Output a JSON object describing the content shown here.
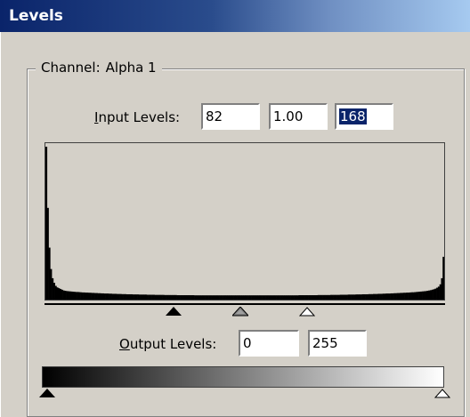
{
  "window": {
    "title": "Levels"
  },
  "channel": {
    "label": "Channel:",
    "value": "Alpha 1"
  },
  "input_levels": {
    "label_first": "I",
    "label_rest": "nput Levels:",
    "black": "82",
    "gamma": "1.00",
    "white": "168"
  },
  "output_levels": {
    "label_first": "O",
    "label_rest": "utput Levels:",
    "black": "0",
    "white": "255"
  },
  "histogram": {
    "levels": 256,
    "counts": [
      1.0,
      0.6,
      0.34,
      0.2,
      0.14,
      0.11,
      0.09,
      0.08,
      0.075,
      0.07,
      0.065,
      0.06,
      0.058,
      0.056,
      0.055,
      0.054,
      0.053,
      0.052,
      0.051,
      0.05,
      0.05,
      0.049,
      0.048,
      0.047,
      0.047,
      0.046,
      0.046,
      0.045,
      0.045,
      0.044,
      0.044,
      0.043,
      0.043,
      0.042,
      0.042,
      0.041,
      0.041,
      0.04,
      0.04,
      0.04,
      0.039,
      0.039,
      0.038,
      0.038,
      0.038,
      0.037,
      0.037,
      0.037,
      0.036,
      0.036,
      0.036,
      0.035,
      0.035,
      0.035,
      0.035,
      0.034,
      0.034,
      0.034,
      0.034,
      0.033,
      0.033,
      0.033,
      0.033,
      0.033,
      0.032,
      0.032,
      0.032,
      0.032,
      0.032,
      0.031,
      0.031,
      0.031,
      0.031,
      0.031,
      0.031,
      0.03,
      0.03,
      0.03,
      0.03,
      0.03,
      0.03,
      0.03,
      0.03,
      0.029,
      0.029,
      0.029,
      0.029,
      0.029,
      0.029,
      0.029,
      0.029,
      0.029,
      0.029,
      0.029,
      0.028,
      0.028,
      0.028,
      0.028,
      0.028,
      0.028,
      0.028,
      0.028,
      0.028,
      0.028,
      0.028,
      0.028,
      0.028,
      0.028,
      0.028,
      0.028,
      0.028,
      0.028,
      0.028,
      0.028,
      0.028,
      0.028,
      0.028,
      0.028,
      0.028,
      0.028,
      0.028,
      0.028,
      0.028,
      0.028,
      0.028,
      0.028,
      0.028,
      0.028,
      0.028,
      0.028,
      0.028,
      0.028,
      0.028,
      0.028,
      0.028,
      0.028,
      0.028,
      0.028,
      0.028,
      0.028,
      0.028,
      0.028,
      0.028,
      0.028,
      0.028,
      0.028,
      0.028,
      0.028,
      0.028,
      0.028,
      0.028,
      0.028,
      0.028,
      0.028,
      0.028,
      0.028,
      0.028,
      0.028,
      0.028,
      0.028,
      0.029,
      0.029,
      0.029,
      0.029,
      0.029,
      0.029,
      0.029,
      0.029,
      0.029,
      0.029,
      0.029,
      0.029,
      0.03,
      0.03,
      0.03,
      0.03,
      0.03,
      0.03,
      0.03,
      0.03,
      0.031,
      0.031,
      0.031,
      0.031,
      0.031,
      0.031,
      0.032,
      0.032,
      0.032,
      0.032,
      0.032,
      0.033,
      0.033,
      0.033,
      0.033,
      0.033,
      0.034,
      0.034,
      0.034,
      0.034,
      0.035,
      0.035,
      0.035,
      0.035,
      0.036,
      0.036,
      0.036,
      0.037,
      0.037,
      0.037,
      0.038,
      0.038,
      0.038,
      0.039,
      0.039,
      0.04,
      0.04,
      0.04,
      0.041,
      0.041,
      0.042,
      0.042,
      0.043,
      0.043,
      0.044,
      0.044,
      0.045,
      0.045,
      0.046,
      0.046,
      0.047,
      0.048,
      0.048,
      0.049,
      0.05,
      0.051,
      0.052,
      0.053,
      0.054,
      0.055,
      0.056,
      0.058,
      0.06,
      0.062,
      0.065,
      0.068,
      0.072,
      0.078,
      0.085,
      0.1,
      0.14,
      0.28
    ]
  },
  "colors": {
    "dialog_bg": "#d4d0c8",
    "title_start": "#0a246a",
    "title_end": "#a6caf0",
    "selection": "#0a246a"
  },
  "icons": {
    "input_black": "triangle-black-icon",
    "input_gray": "triangle-gray-icon",
    "input_white": "triangle-white-icon",
    "output_black": "triangle-black-icon",
    "output_white": "triangle-white-icon"
  }
}
